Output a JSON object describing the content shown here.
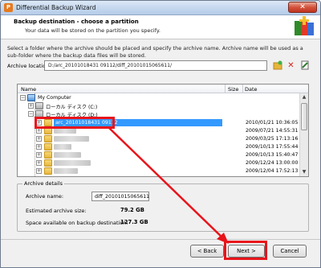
{
  "window": {
    "title": "Differential Backup Wizard",
    "app_icon_glyph": "P",
    "close_glyph": "✕"
  },
  "header": {
    "title": "Backup destination - choose a partition",
    "subtitle": "Your data will be stored on the partition you specify."
  },
  "description": "Select a folder where the archive should be placed and specify the archive name. Archive name will be used as a sub-folder where the backup data files will be stored.",
  "location": {
    "label": "Archive location:",
    "value": "D:/arc_20101018431 09112/diff_20101015065611/"
  },
  "toolbar_icons": [
    "new-folder-icon",
    "delete-icon",
    "properties-icon"
  ],
  "tree": {
    "columns": {
      "name": "Name",
      "size": "Size",
      "date": "Date"
    },
    "root": "My Computer",
    "drive_c": "ローカル ディスク (C:)",
    "drive_d": "ローカル ディスク (D:)",
    "selected_folder": "arc_20101018431 09112",
    "dates": [
      "2010/01/21 10:36:05",
      "2009/07/21 14:55:31",
      "2009/03/25 17:13:16",
      "2009/10/13 17:55:44",
      "2009/10/13 15:40:47",
      "2009/12/24 13:00:00",
      "2009/12/04 17:52:13"
    ]
  },
  "details": {
    "title": "Archive details",
    "name_label": "Archive name:",
    "name_value": "diff_20101015065611",
    "size_label": "Estimated archive size:",
    "size_value": "79.2 GB",
    "space_label": "Space available on backup destination:",
    "space_value": "127.3 GB"
  },
  "buttons": {
    "back": "< Back",
    "next": "Next >",
    "cancel": "Cancel"
  },
  "colors": {
    "highlight": "#e8141b",
    "selection": "#3399ff"
  }
}
